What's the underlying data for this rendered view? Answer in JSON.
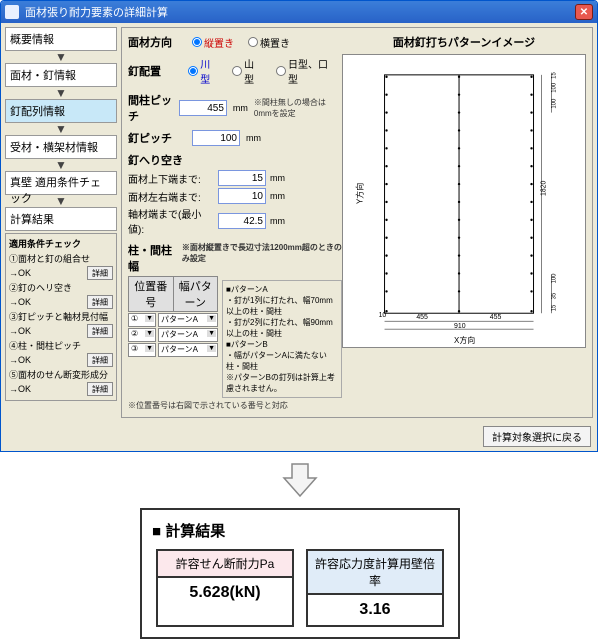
{
  "window": {
    "title": "面材張り耐力要素の詳細計算"
  },
  "sidebar": {
    "items": [
      {
        "label": "概要情報"
      },
      {
        "label": "面材・釘情報"
      },
      {
        "label": "釘配列情報"
      },
      {
        "label": "受材・横架材情報"
      },
      {
        "label": "真壁 適用条件チェック"
      },
      {
        "label": "計算結果"
      }
    ],
    "checks": {
      "title": "適用条件チェック",
      "items": [
        {
          "name": "①面材と釘の組合せ",
          "status": "→OK",
          "btn": "詳細"
        },
        {
          "name": "②釘のヘリ空き",
          "status": "→OK",
          "btn": "詳細"
        },
        {
          "name": "③釘ピッチと軸材見付幅",
          "status": "→OK",
          "btn": "詳細"
        },
        {
          "name": "④柱・間柱ピッチ",
          "status": "→OK",
          "btn": "詳細"
        },
        {
          "name": "⑤面材のせん断変形成分",
          "status": "→OK",
          "btn": "詳細"
        }
      ]
    }
  },
  "form": {
    "direction": {
      "label": "面材方向",
      "opts": [
        "縦置き",
        "横置き"
      ],
      "sel": 0
    },
    "layout": {
      "label": "釘配置",
      "opts": [
        "川型",
        "山型",
        "日型、口型"
      ],
      "sel": 0
    },
    "mabashira": {
      "label": "間柱ピッチ",
      "value": "455",
      "unit": "mm",
      "note": "※間柱無しの場合は0mmを設定"
    },
    "nailpitch": {
      "label": "釘ピッチ",
      "value": "100",
      "unit": "mm"
    },
    "heri": {
      "label": "釘へり空き",
      "rows": [
        {
          "label": "面材上下端まで:",
          "value": "15",
          "unit": "mm"
        },
        {
          "label": "面材左右端まで:",
          "value": "10",
          "unit": "mm"
        },
        {
          "label": "軸材端まで(最小値):",
          "value": "42.5",
          "unit": "mm"
        }
      ]
    },
    "pillar": {
      "label": "柱・間柱幅",
      "note": "※面材縦置きで長辺寸法1200mm超のときのみ設定",
      "headers": [
        "位置番号",
        "幅パターン"
      ],
      "rows": [
        {
          "pos": "①",
          "pat": "パターンA"
        },
        {
          "pos": "②",
          "pat": "パターンA"
        },
        {
          "pos": "③",
          "pat": "パターンA"
        }
      ],
      "patA": {
        "title": "■パターンA",
        "lines": [
          "・釘が1列に打たれ、幅70mm以上の柱・間柱",
          "・釘が2列に打たれ、幅90mm以上の柱・間柱"
        ]
      },
      "patB": {
        "title": "■パターンB",
        "lines": [
          "・幅がパターンAに満たない柱・間柱",
          "※パターンBの釘列は計算上考慮されません。"
        ]
      },
      "foot": "※位置番号は右図で示されている番号と対応"
    }
  },
  "imagepanel": {
    "title": "面材釘打ちパターンイメージ"
  },
  "diagram": {
    "ylabel": "Y方向",
    "xlabel": "X方向",
    "width": "910",
    "left": "455",
    "right": "455",
    "height": "1820",
    "top1": "15",
    "top2": "100",
    "top3": "100",
    "bot1": "100",
    "bot2": "35",
    "bot3": "15",
    "m": "10"
  },
  "footer": {
    "back": "計算対象選択に戻る"
  },
  "result": {
    "title": "■ 計算結果",
    "cells": [
      {
        "title": "許容せん断耐力Pa",
        "value": "5.628(kN)"
      },
      {
        "title": "許容応力度計算用壁倍率",
        "value": "3.16"
      }
    ]
  }
}
